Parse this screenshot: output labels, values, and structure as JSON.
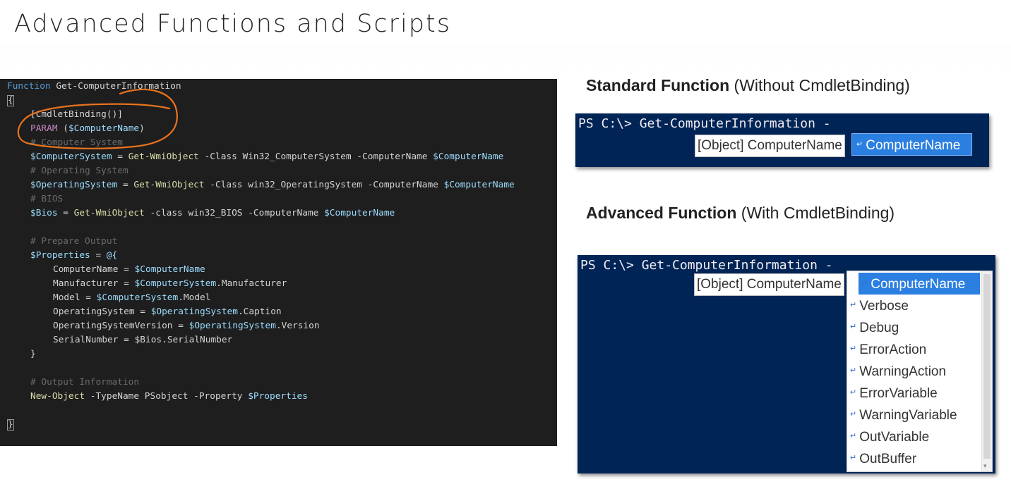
{
  "slide": {
    "title": "Advanced Functions and Scripts"
  },
  "code": {
    "l1_kw": "Function",
    "l1_name": " Get-ComputerInformation",
    "l2": "{",
    "l3": "[CmdletBinding()]",
    "l4_kw": "PARAM",
    "l4_a": " (",
    "l4_var": "$ComputerName",
    "l4_b": ")",
    "l5": "# Computer System",
    "l6_var": "$ComputerSystem",
    "l6_a": " = ",
    "l6_cmd": "Get-WmiObject",
    "l6_b": " -Class Win32_ComputerSystem -ComputerName ",
    "l6_var2": "$ComputerName",
    "l7": "# Operating System",
    "l8_var": "$OperatingSystem",
    "l8_a": " = ",
    "l8_cmd": "Get-WmiObject",
    "l8_b": " -Class win32_OperatingSystem -ComputerName ",
    "l8_var2": "$ComputerName",
    "l9": "# BIOS",
    "l10_var": "$Bios",
    "l10_a": " = ",
    "l10_cmd": "Get-WmiObject",
    "l10_b": " -class win32_BIOS -ComputerName ",
    "l10_var2": "$ComputerName",
    "l11": "# Prepare Output",
    "l12_var": "$Properties",
    "l12_a": " = ",
    "l12_b": "@{",
    "l13_a": "ComputerName = ",
    "l13_var": "$ComputerName",
    "l14_a": "Manufacturer = ",
    "l14_var": "$ComputerSystem",
    "l14_b": ".Manufacturer",
    "l15_a": "Model = ",
    "l15_var": "$ComputerSystem",
    "l15_b": ".Model",
    "l16_a": "OperatingSystem = ",
    "l16_var": "$OperatingSystem",
    "l16_b": ".Caption",
    "l17_a": "OperatingSystemVersion = ",
    "l17_var": "$OperatingSystem",
    "l17_b": ".Version",
    "l18_a": "SerialNumber = ",
    "l18_var": "$Bios",
    "l18_b": ".SerialNumber",
    "l19": "}",
    "l20": "# Output Information",
    "l21_cmd": "New-Object",
    "l21_a": " -TypeName PSobject -Property ",
    "l21_var": "$Properties",
    "l22": "}"
  },
  "standard": {
    "heading_bold": "Standard Function",
    "heading_rest": " (Without CmdletBinding)",
    "prompt": "PS C:\\> Get-ComputerInformation -",
    "tooltip": "[Object] ComputerName",
    "selected": "ComputerName"
  },
  "advanced": {
    "heading_bold": "Advanced Function",
    "heading_rest": " (With CmdletBinding)",
    "prompt": "PS C:\\> Get-ComputerInformation -",
    "tooltip": "[Object] ComputerName",
    "items": [
      "ComputerName",
      "Verbose",
      "Debug",
      "ErrorAction",
      "WarningAction",
      "ErrorVariable",
      "WarningVariable",
      "OutVariable",
      "OutBuffer"
    ]
  },
  "colors": {
    "console_bg": "#012456",
    "editor_bg": "#1e1e1e",
    "selection": "#2b7fe0",
    "annotation": "#e8731f"
  }
}
